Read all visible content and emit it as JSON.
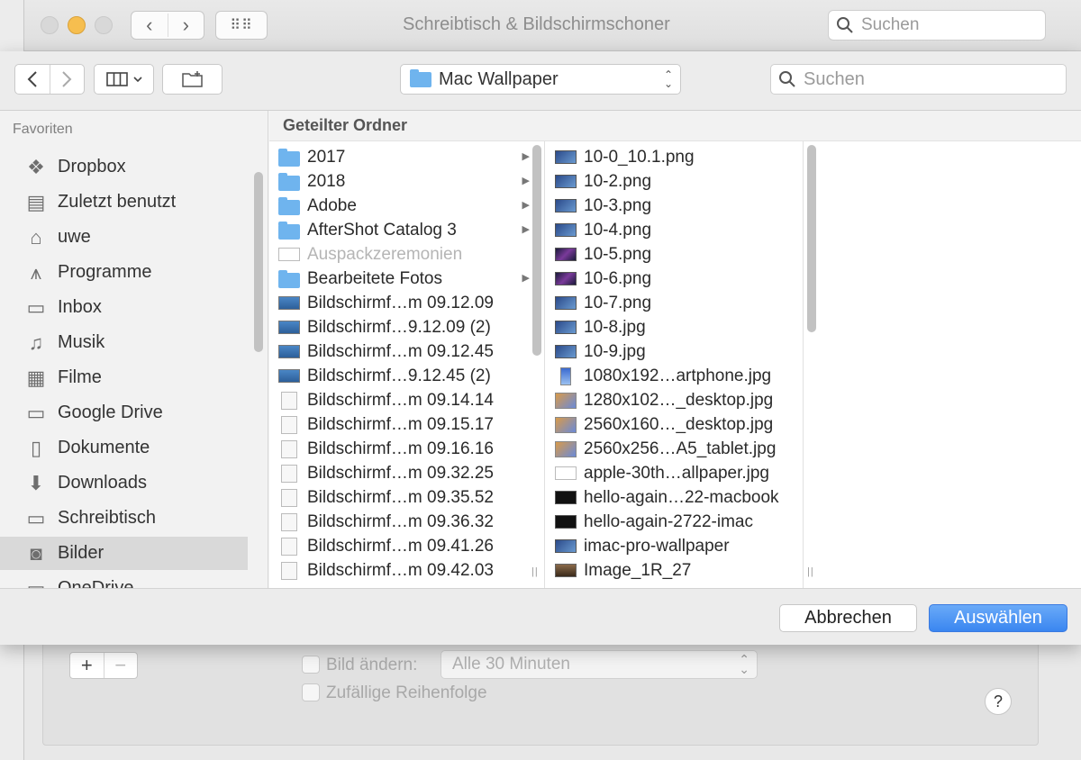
{
  "background_window": {
    "title": "Schreibtisch & Bildschirmschoner",
    "search_placeholder": "Suchen",
    "plus_label": "+",
    "minus_label": "−",
    "change_picture_label": "Bild ändern:",
    "interval_value": "Alle 30 Minuten",
    "random_order_label": "Zufällige Reihenfolge",
    "help_label": "?"
  },
  "toolbar": {
    "location_popup": "Mac Wallpaper",
    "search_placeholder": "Suchen"
  },
  "sidebar": {
    "heading": "Favoriten",
    "items": [
      {
        "label": "Dropbox",
        "icon": "dropbox-icon"
      },
      {
        "label": "Zuletzt benutzt",
        "icon": "recents-icon"
      },
      {
        "label": "uwe",
        "icon": "home-icon"
      },
      {
        "label": "Programme",
        "icon": "applications-icon"
      },
      {
        "label": "Inbox",
        "icon": "folder-icon"
      },
      {
        "label": "Musik",
        "icon": "music-icon"
      },
      {
        "label": "Filme",
        "icon": "movies-icon"
      },
      {
        "label": "Google Drive",
        "icon": "folder-icon"
      },
      {
        "label": "Dokumente",
        "icon": "documents-icon"
      },
      {
        "label": "Downloads",
        "icon": "downloads-icon"
      },
      {
        "label": "Schreibtisch",
        "icon": "desktop-icon"
      },
      {
        "label": "Bilder",
        "icon": "camera-icon",
        "selected": true
      },
      {
        "label": "OneDrive",
        "icon": "folder-icon"
      }
    ]
  },
  "browser": {
    "breadcrumb": "Geteilter Ordner",
    "column1": [
      {
        "name": "2017",
        "kind": "folder",
        "disclosure": true
      },
      {
        "name": "2018",
        "kind": "folder",
        "disclosure": true
      },
      {
        "name": "Adobe",
        "kind": "folder",
        "disclosure": true
      },
      {
        "name": "AfterShot Catalog 3",
        "kind": "folder",
        "disclosure": true
      },
      {
        "name": "Auspackzeremonien",
        "kind": "library",
        "dimmed": true
      },
      {
        "name": "Bearbeitete Fotos",
        "kind": "folder",
        "disclosure": true
      },
      {
        "name": "Bildschirmf…m 09.12.09",
        "kind": "screen"
      },
      {
        "name": "Bildschirmf…9.12.09 (2)",
        "kind": "screen"
      },
      {
        "name": "Bildschirmf…m 09.12.45",
        "kind": "screen"
      },
      {
        "name": "Bildschirmf…9.12.45 (2)",
        "kind": "screen"
      },
      {
        "name": "Bildschirmf…m 09.14.14",
        "kind": "doc"
      },
      {
        "name": "Bildschirmf…m 09.15.17",
        "kind": "doc"
      },
      {
        "name": "Bildschirmf…m 09.16.16",
        "kind": "doc"
      },
      {
        "name": "Bildschirmf…m 09.32.25",
        "kind": "doc"
      },
      {
        "name": "Bildschirmf…m 09.35.52",
        "kind": "doc"
      },
      {
        "name": "Bildschirmf…m 09.36.32",
        "kind": "doc"
      },
      {
        "name": "Bildschirmf…m 09.41.26",
        "kind": "doc"
      },
      {
        "name": "Bildschirmf…m 09.42.03",
        "kind": "doc"
      }
    ],
    "column2": [
      {
        "name": "10-0_10.1.png",
        "kind": "bluewall"
      },
      {
        "name": "10-2.png",
        "kind": "bluewall"
      },
      {
        "name": "10-3.png",
        "kind": "bluewall"
      },
      {
        "name": "10-4.png",
        "kind": "bluewall"
      },
      {
        "name": "10-5.png",
        "kind": "galaxy"
      },
      {
        "name": "10-6.png",
        "kind": "galaxy"
      },
      {
        "name": "10-7.png",
        "kind": "bluewall"
      },
      {
        "name": "10-8.jpg",
        "kind": "bluewall"
      },
      {
        "name": "10-9.jpg",
        "kind": "bluewall"
      },
      {
        "name": "1080x192…artphone.jpg",
        "kind": "phone"
      },
      {
        "name": "1280x102…_desktop.jpg",
        "kind": "photo"
      },
      {
        "name": "2560x160…_desktop.jpg",
        "kind": "photo"
      },
      {
        "name": "2560x256…A5_tablet.jpg",
        "kind": "photo"
      },
      {
        "name": "apple-30th…allpaper.jpg",
        "kind": "white"
      },
      {
        "name": "hello-again…22-macbook",
        "kind": "black"
      },
      {
        "name": "hello-again-2722-imac",
        "kind": "black"
      },
      {
        "name": "imac-pro-wallpaper",
        "kind": "bluewall"
      },
      {
        "name": "Image_1R_27",
        "kind": "landscape"
      }
    ]
  },
  "footer": {
    "cancel_label": "Abbrechen",
    "choose_label": "Auswählen"
  }
}
